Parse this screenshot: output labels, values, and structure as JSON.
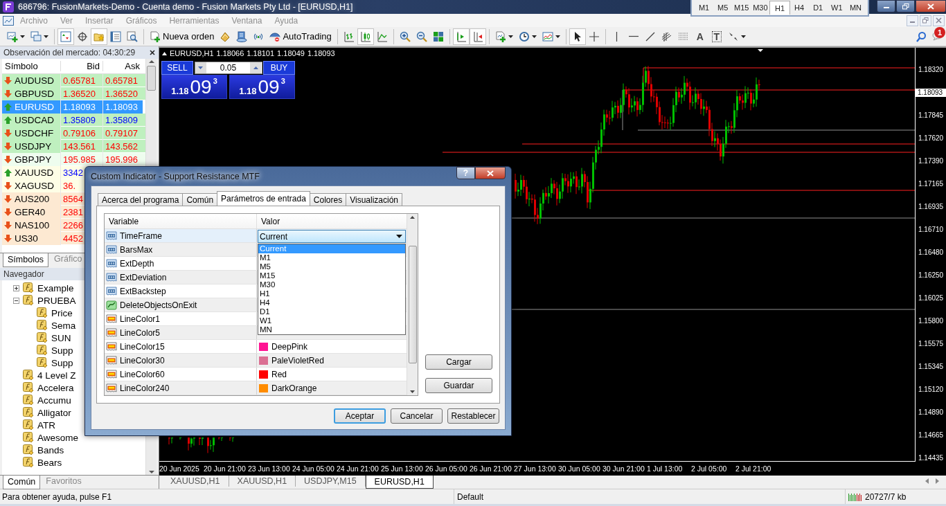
{
  "window": {
    "title": "686796: FusionMarkets-Demo - Cuenta demo - Fusion Markets Pty Ltd - [EURUSD,H1]"
  },
  "timeframes": [
    {
      "label": "M1",
      "selected": false
    },
    {
      "label": "M5",
      "selected": false
    },
    {
      "label": "M15",
      "selected": false
    },
    {
      "label": "M30",
      "selected": false
    },
    {
      "label": "H1",
      "selected": true
    },
    {
      "label": "H4",
      "selected": false
    },
    {
      "label": "D1",
      "selected": false
    },
    {
      "label": "W1",
      "selected": false
    },
    {
      "label": "MN",
      "selected": false
    }
  ],
  "menu": [
    {
      "label": "Archivo",
      "disabled": true
    },
    {
      "label": "Ver",
      "disabled": true
    },
    {
      "label": "Insertar",
      "disabled": true
    },
    {
      "label": "Gráficos",
      "disabled": true
    },
    {
      "label": "Herramientas",
      "disabled": true
    },
    {
      "label": "Ventana",
      "disabled": true
    },
    {
      "label": "Ayuda",
      "disabled": true
    }
  ],
  "toolbar": {
    "items": [
      {
        "kind": "new-chart",
        "pressed": false
      },
      {
        "kind": "profiles",
        "pressed": false
      },
      {
        "kind": "separator"
      },
      {
        "kind": "market-watch",
        "pressed": true
      },
      {
        "kind": "data-window",
        "pressed": false
      },
      {
        "kind": "navigator",
        "pressed": true
      },
      {
        "kind": "terminal",
        "pressed": false
      },
      {
        "kind": "tester",
        "pressed": false
      },
      {
        "kind": "separator"
      },
      {
        "kind": "new-order",
        "label": "Nueva orden",
        "pressed": false
      },
      {
        "kind": "metaeditor",
        "pressed": false
      },
      {
        "kind": "signals",
        "pressed": false
      },
      {
        "kind": "broadcast",
        "pressed": false
      },
      {
        "kind": "autotrading",
        "label": "AutoTrading",
        "pressed": false
      },
      {
        "kind": "separator"
      },
      {
        "kind": "bar-chart",
        "pressed": false
      },
      {
        "kind": "candles",
        "pressed": true
      },
      {
        "kind": "line-chart",
        "pressed": false
      },
      {
        "kind": "separator"
      },
      {
        "kind": "zoom-in",
        "pressed": false
      },
      {
        "kind": "zoom-out",
        "pressed": false
      },
      {
        "kind": "tile",
        "pressed": false
      },
      {
        "kind": "separator"
      },
      {
        "kind": "autoscroll",
        "pressed": true
      },
      {
        "kind": "chart-shift",
        "pressed": true
      },
      {
        "kind": "separator"
      },
      {
        "kind": "indicators",
        "pressed": false
      },
      {
        "kind": "periods",
        "pressed": false
      },
      {
        "kind": "templates",
        "pressed": false
      },
      {
        "kind": "separator"
      },
      {
        "kind": "cursor",
        "pressed": true
      },
      {
        "kind": "crosshair",
        "pressed": false
      },
      {
        "kind": "separator"
      },
      {
        "kind": "vline",
        "pressed": false
      },
      {
        "kind": "hline",
        "pressed": false
      },
      {
        "kind": "trendline",
        "pressed": false
      },
      {
        "kind": "fibo-channel",
        "pressed": false
      },
      {
        "kind": "fibo",
        "pressed": false
      },
      {
        "kind": "text",
        "glyph": "A",
        "pressed": false
      },
      {
        "kind": "label",
        "glyph": "T",
        "pressed": false
      },
      {
        "kind": "arrows",
        "pressed": false
      },
      {
        "kind": "spacer"
      },
      {
        "kind": "search",
        "pressed": false
      },
      {
        "kind": "chat",
        "badge": "1",
        "pressed": false
      }
    ]
  },
  "market_watch": {
    "title": "Observación del mercado: 04:30:29",
    "columns": [
      "Símbolo",
      "Bid",
      "Ask"
    ],
    "rows": [
      {
        "symbol": "AUDUSD",
        "bid": "0.65781",
        "ask": "0.65781",
        "up": false,
        "color": "#bff0bf",
        "selected": false
      },
      {
        "symbol": "GBPUSD",
        "bid": "1.36520",
        "ask": "1.36520",
        "up": false,
        "color": "#bff0bf",
        "selected": false
      },
      {
        "symbol": "EURUSD",
        "bid": "1.18093",
        "ask": "1.18093",
        "up": true,
        "selected": true
      },
      {
        "symbol": "USDCAD",
        "bid": "1.35809",
        "ask": "1.35809",
        "up": true,
        "color": "#bff0bf",
        "selected": false
      },
      {
        "symbol": "USDCHF",
        "bid": "0.79106",
        "ask": "0.79107",
        "up": false,
        "color": "#bff0bf",
        "selected": false
      },
      {
        "symbol": "USDJPY",
        "bid": "143.561",
        "ask": "143.562",
        "up": false,
        "color": "#bff0bf",
        "selected": false
      },
      {
        "symbol": "GBPJPY",
        "bid": "195.985",
        "ask": "195.996",
        "up": false,
        "color": "#eefdee",
        "selected": false
      },
      {
        "symbol": "XAUUSD",
        "bid": "3342",
        "up": true,
        "color": "#fefee6",
        "selected": false
      },
      {
        "symbol": "XAGUSD",
        "bid": "36.",
        "up": false,
        "color": "#fefee6",
        "selected": false
      },
      {
        "symbol": "AUS200",
        "bid": "8564",
        "up": false,
        "color": "#fde9d2",
        "selected": false
      },
      {
        "symbol": "GER40",
        "bid": "2381",
        "up": false,
        "color": "#fde9d2",
        "selected": false
      },
      {
        "symbol": "NAS100",
        "bid": "2266",
        "up": false,
        "color": "#fde9d2",
        "selected": false
      },
      {
        "symbol": "US30",
        "bid": "4452",
        "up": false,
        "color": "#fde9d2",
        "selected": false
      }
    ],
    "tabs": [
      {
        "label": "Símbolos",
        "selected": true
      },
      {
        "label": "Gráfico",
        "selected": false
      }
    ]
  },
  "navigator": {
    "title": "Navegador",
    "tree": [
      {
        "label": "Example",
        "expanded": false
      },
      {
        "label": "PRUEBA",
        "expanded": true,
        "children": [
          {
            "label": "Price"
          },
          {
            "label": "Sema"
          },
          {
            "label": "SUN"
          },
          {
            "label": "Supp"
          },
          {
            "label": "Supp"
          }
        ]
      },
      {
        "label": "4 Level Z"
      },
      {
        "label": "Accelera"
      },
      {
        "label": "Accumu"
      },
      {
        "label": "Alligator"
      },
      {
        "label": "ATR"
      },
      {
        "label": "Awesome"
      },
      {
        "label": "Bands"
      },
      {
        "label": "Bears"
      }
    ],
    "tabs": [
      {
        "label": "Común",
        "selected": true
      },
      {
        "label": "Favoritos",
        "selected": false
      }
    ]
  },
  "chart": {
    "symbol": "EURUSD,H1",
    "quotes": [
      "1.18066",
      "1.18101",
      "1.18049",
      "1.18093"
    ],
    "trade_panel": {
      "sell": "SELL",
      "buy": "BUY",
      "volume": "0.05",
      "sell_price": {
        "prefix": "1.18",
        "main": "09",
        "suffix": "3"
      },
      "buy_price": {
        "prefix": "1.18",
        "main": "09",
        "suffix": "3"
      }
    },
    "price_labels": [
      {
        "label": "1.18320",
        "current": false
      },
      {
        "label": "1.18093",
        "current": true
      },
      {
        "label": "1.17845",
        "current": false
      },
      {
        "label": "1.17620",
        "current": false
      },
      {
        "label": "1.17390",
        "current": false
      },
      {
        "label": "1.17165",
        "current": false
      },
      {
        "label": "1.16935",
        "current": false
      },
      {
        "label": "1.16710",
        "current": false
      },
      {
        "label": "1.16480",
        "current": false
      },
      {
        "label": "1.16250",
        "current": false
      },
      {
        "label": "1.16025",
        "current": false
      },
      {
        "label": "1.15800",
        "current": false
      },
      {
        "label": "1.15575",
        "current": false
      },
      {
        "label": "1.15345",
        "current": false
      },
      {
        "label": "1.15120",
        "current": false
      },
      {
        "label": "1.14890",
        "current": false
      },
      {
        "label": "1.14665",
        "current": false
      },
      {
        "label": "1.14435",
        "current": false
      }
    ],
    "time_labels": [
      "20 Jun 2025",
      "20 Jun 21:00",
      "23 Jun 13:00",
      "24 Jun 05:00",
      "24 Jun 21:00",
      "25 Jun 13:00",
      "26 Jun 05:00",
      "26 Jun 21:00",
      "27 Jun 13:00",
      "30 Jun 05:00",
      "30 Jun 21:00",
      "1 Jul 13:00",
      "2 Jul 05:00",
      "2 Jul 21:00"
    ]
  },
  "chart_tabs": [
    {
      "label": "XAUUSD,H1",
      "selected": false
    },
    {
      "label": "XAUUSD,H1",
      "selected": false
    },
    {
      "label": "USDJPY,M15",
      "selected": false
    },
    {
      "label": "EURUSD,H1",
      "selected": true
    }
  ],
  "status_bar": {
    "help": "Para obtener ayuda, pulse F1",
    "profile": "Default",
    "traffic": "20727/7 kb"
  },
  "dialog": {
    "title": "Custom Indicator - Support Resistance MTF",
    "help": "?",
    "tabs": [
      {
        "label": "Acerca del programa",
        "selected": false
      },
      {
        "label": "Común",
        "selected": false
      },
      {
        "label": "Parámetros de entrada",
        "selected": true
      },
      {
        "label": "Colores",
        "selected": false
      },
      {
        "label": "Visualización",
        "selected": false
      }
    ],
    "columns": [
      "Variable",
      "Valor"
    ],
    "rows": [
      {
        "name": "TimeFrame",
        "kind": "number",
        "selected": true,
        "dropdown": {
          "value": "Current",
          "expanded": true,
          "options": [
            {
              "label": "Current",
              "selected": true
            },
            {
              "label": "M1",
              "selected": false
            },
            {
              "label": "M5",
              "selected": false
            },
            {
              "label": "M15",
              "selected": false
            },
            {
              "label": "M30",
              "selected": false
            },
            {
              "label": "H1",
              "selected": false
            },
            {
              "label": "H4",
              "selected": false
            },
            {
              "label": "D1",
              "selected": false
            },
            {
              "label": "W1",
              "selected": false
            },
            {
              "label": "MN",
              "selected": false
            }
          ]
        }
      },
      {
        "name": "BarsMax",
        "kind": "number",
        "selected": false
      },
      {
        "name": "ExtDepth",
        "kind": "number",
        "selected": false
      },
      {
        "name": "ExtDeviation",
        "kind": "number",
        "selected": false
      },
      {
        "name": "ExtBackstep",
        "kind": "number",
        "selected": false
      },
      {
        "name": "DeleteObjectsOnExit",
        "kind": "bool",
        "selected": false
      },
      {
        "name": "LineColor1",
        "kind": "color",
        "selected": false
      },
      {
        "name": "LineColor5",
        "kind": "color",
        "selected": false
      },
      {
        "name": "LineColor15",
        "kind": "color",
        "selected": false,
        "value": "DeepPink",
        "color": "#ff1493"
      },
      {
        "name": "LineColor30",
        "kind": "color",
        "selected": false,
        "value": "PaleVioletRed",
        "color": "#db7093"
      },
      {
        "name": "LineColor60",
        "kind": "color",
        "selected": false,
        "value": "Red",
        "color": "#ff0000"
      },
      {
        "name": "LineColor240",
        "kind": "color",
        "selected": false,
        "value": "DarkOrange",
        "color": "#ff8c00"
      }
    ],
    "side_buttons": [
      {
        "label": "Cargar"
      },
      {
        "label": "Guardar"
      }
    ],
    "buttons": [
      {
        "label": "Aceptar",
        "default": true
      },
      {
        "label": "Cancelar",
        "default": false
      },
      {
        "label": "Restablecer",
        "default": false
      }
    ]
  }
}
